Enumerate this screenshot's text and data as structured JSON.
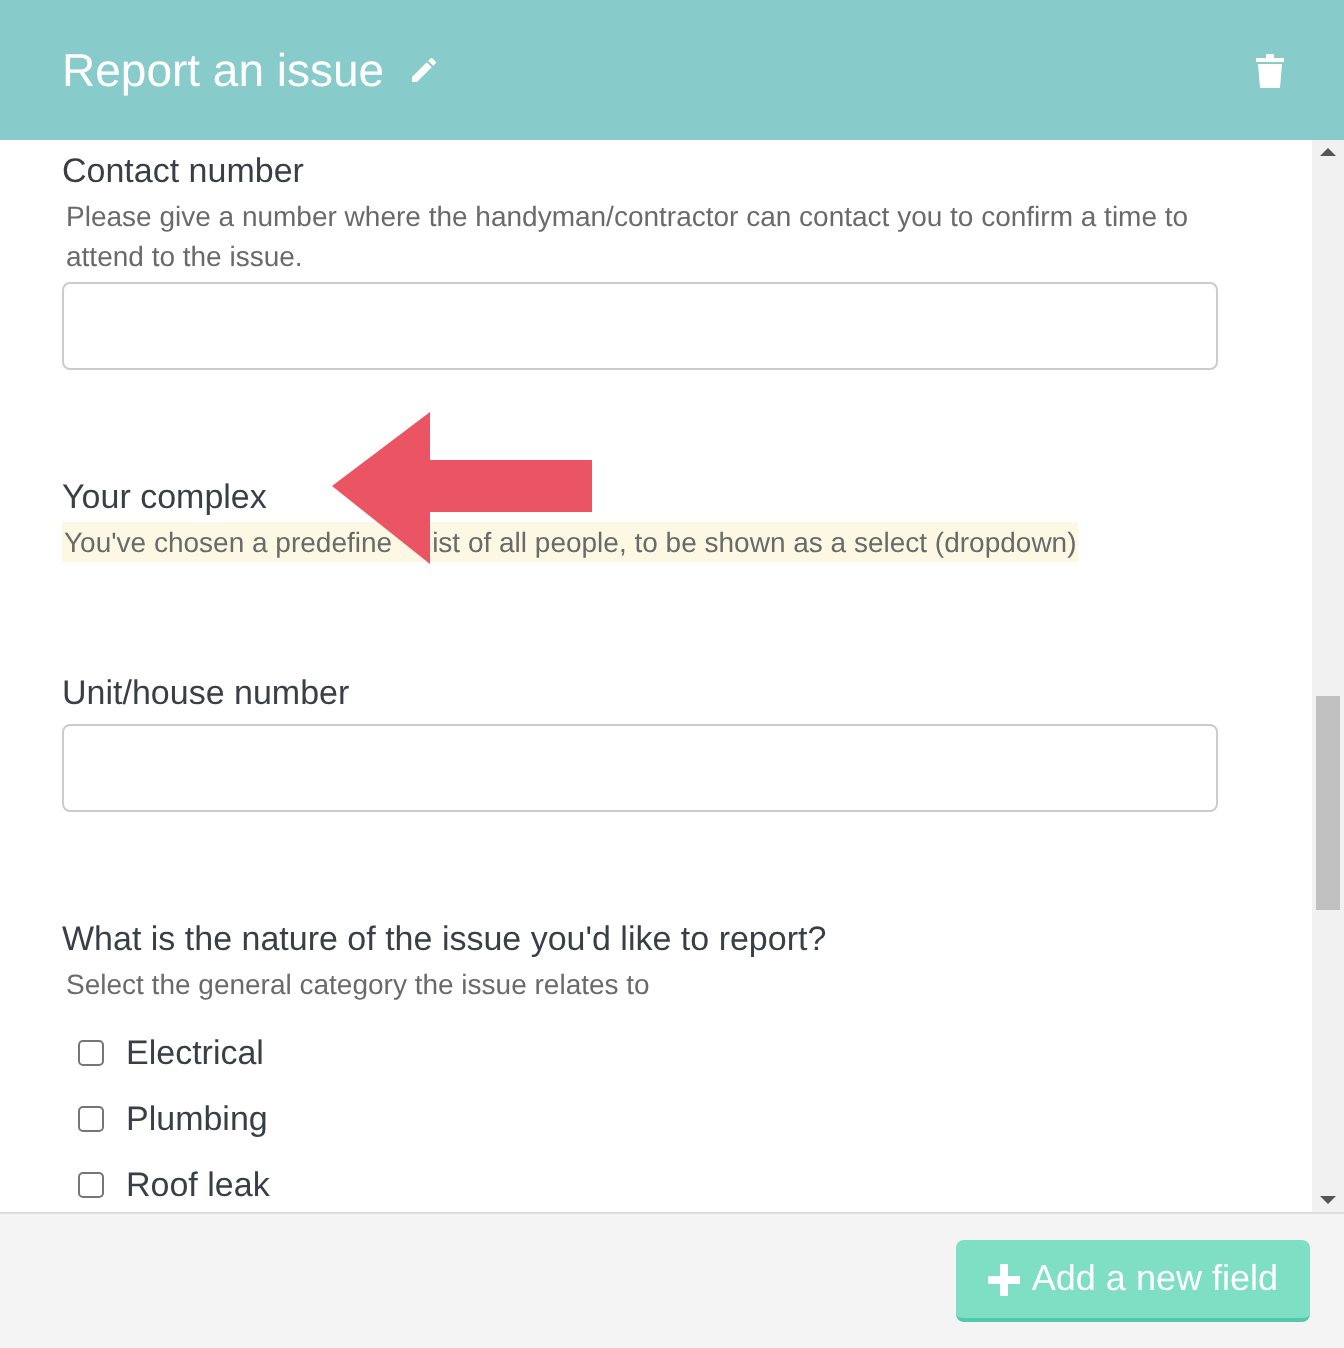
{
  "header": {
    "title": "Report an issue"
  },
  "fields": [
    {
      "kind": "text",
      "label": "Contact number",
      "hint": "Please give a number where the handyman/contractor can contact you to confirm a time to attend to the issue."
    },
    {
      "kind": "notice",
      "label": "Your complex",
      "hint_parts": [
        "You've chosen a predefine",
        "ist of all people, to be shown as a select (dropdown)"
      ]
    },
    {
      "kind": "text",
      "label": "Unit/house number"
    },
    {
      "kind": "checkboxes",
      "label": "What is the nature of the issue you'd like to report?",
      "hint": "Select the general category the issue relates to",
      "options": [
        {
          "label": "Electrical",
          "checked": false
        },
        {
          "label": "Plumbing",
          "checked": false
        },
        {
          "label": "Roof leak",
          "checked": false
        }
      ]
    }
  ],
  "footer": {
    "button": "Add a new field"
  }
}
